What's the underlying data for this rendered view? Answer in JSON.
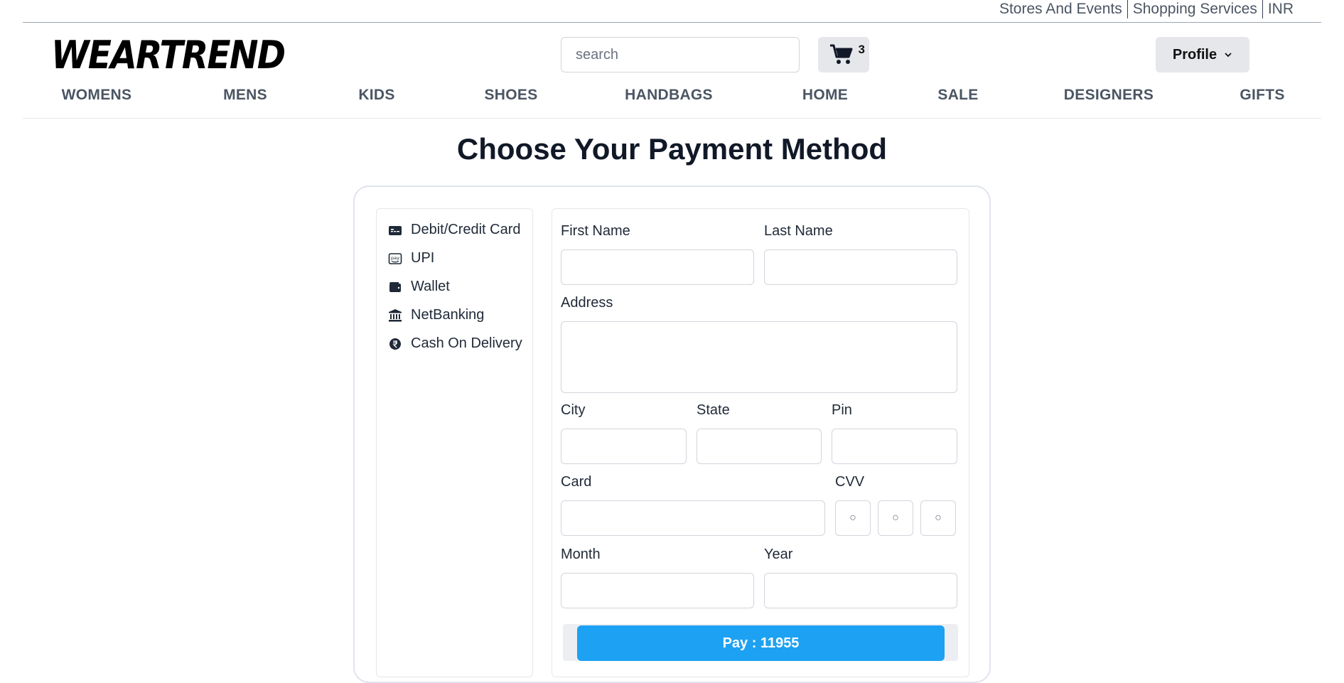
{
  "utility_links": [
    "Stores And Events",
    "Shopping Services",
    "INR"
  ],
  "brand": {
    "logo_text": "WEARTREND"
  },
  "search": {
    "placeholder": "search",
    "value": ""
  },
  "cart": {
    "count": "3",
    "icon": "shopping-cart-icon"
  },
  "profile": {
    "label": "Profile",
    "icon": "chevron-down-icon"
  },
  "nav": [
    "WOMENS",
    "MENS",
    "KIDS",
    "SHOES",
    "HANDBAGS",
    "HOME",
    "SALE",
    "DESIGNERS",
    "GIFTS"
  ],
  "page": {
    "title": "Choose Your Payment Method"
  },
  "payment_methods": [
    {
      "label": "Debit/Credit Card",
      "icon": "credit-card-icon"
    },
    {
      "label": "UPI",
      "icon": "upi-pay-icon"
    },
    {
      "label": "Wallet",
      "icon": "wallet-icon"
    },
    {
      "label": "NetBanking",
      "icon": "bank-icon"
    },
    {
      "label": "Cash On Delivery",
      "icon": "rupee-icon"
    }
  ],
  "form": {
    "first_name": {
      "label": "First Name",
      "value": ""
    },
    "last_name": {
      "label": "Last Name",
      "value": ""
    },
    "address": {
      "label": "Address",
      "value": ""
    },
    "city": {
      "label": "City",
      "value": ""
    },
    "state": {
      "label": "State",
      "value": ""
    },
    "pin": {
      "label": "Pin",
      "value": ""
    },
    "card": {
      "label": "Card",
      "value": ""
    },
    "cvv": {
      "label": "CVV",
      "placeholder": "○"
    },
    "month": {
      "label": "Month",
      "value": ""
    },
    "year": {
      "label": "Year",
      "value": ""
    },
    "pay_label": "Pay : 11955"
  },
  "colors": {
    "accent": "#1da1f2",
    "button_bg": "#e5e7eb",
    "text": "#111827"
  }
}
